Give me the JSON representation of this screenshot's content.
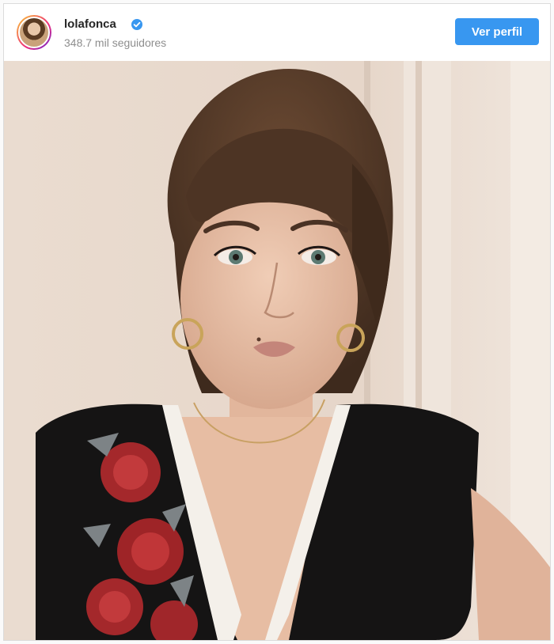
{
  "post": {
    "username": "lolafonca",
    "followers": "348.7 mil seguidores",
    "button_label": "Ver perfil",
    "verified": true
  },
  "colors": {
    "accent": "#3897f0",
    "username": "#262626",
    "secondary_text": "#8e8e8e"
  },
  "icons": {
    "verified": "verified-badge-icon",
    "avatar": "profile-avatar"
  }
}
